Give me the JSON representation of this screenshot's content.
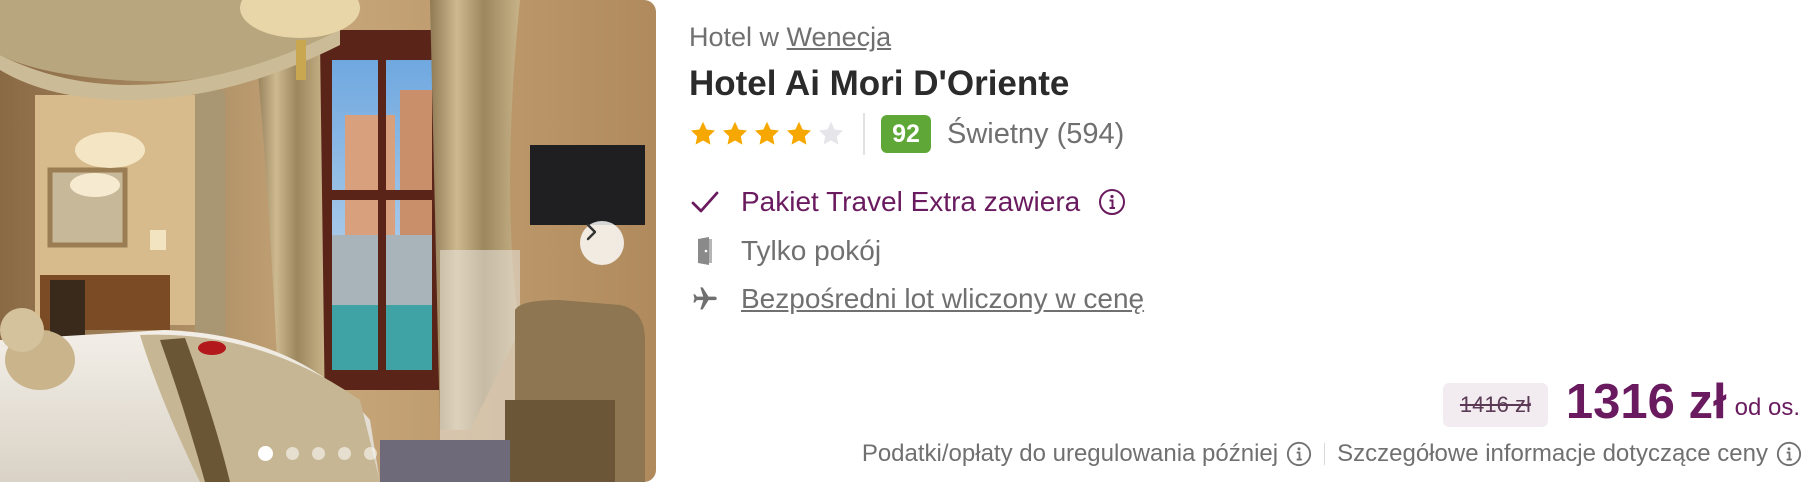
{
  "location": {
    "prefix": "Hotel w",
    "city": "Wenecja"
  },
  "hotel": {
    "name": "Hotel Ai Mori D'Oriente"
  },
  "rating": {
    "stars_filled": 4,
    "stars_total": 5,
    "score": "92",
    "label": "Świetny (594)",
    "star_color": "#f6a800",
    "score_color": "#5fa737"
  },
  "features": [
    {
      "icon": "check-icon",
      "label": "Pakiet Travel Extra zawiera"
    },
    {
      "icon": "door-icon",
      "label": "Tylko pokój"
    },
    {
      "icon": "plane-icon",
      "label": "Bezpośredni lot wliczony w cenę"
    }
  ],
  "price": {
    "old": "1416 zł",
    "current": "1316 zł",
    "per_person": "od os.",
    "accent_color": "#6a1b5f"
  },
  "notes": {
    "taxes": "Podatki/opłaty do uregulowania później",
    "details": "Szczegółowe informacje dotyczące ceny"
  },
  "gallery": {
    "slides": 5,
    "active_slide": 1
  }
}
